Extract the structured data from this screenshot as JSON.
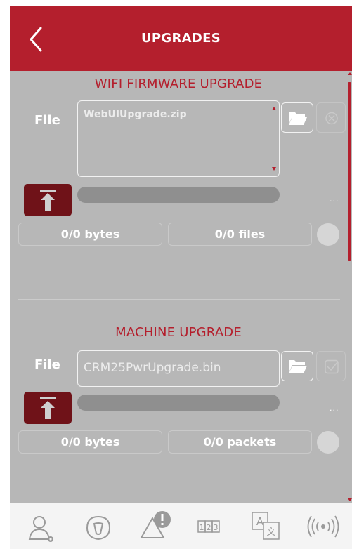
{
  "header": {
    "title": "UPGRADES",
    "back_icon": "chevron-left-icon"
  },
  "colors": {
    "brand_red": "#b41f2d",
    "dark_red": "#6f1218",
    "panel_gray": "#b7b7b7"
  },
  "wifi_section": {
    "title": "WIFI FIRMWARE UPGRADE",
    "file_label": "File",
    "file_value": "WebUIUpgrade.zip",
    "progress": 0,
    "bytes": "0/0 bytes",
    "files": "0/0 files",
    "dots": "..."
  },
  "machine_section": {
    "title": "MACHINE UPGRADE",
    "file_label": "File",
    "file_value": "CRM25PwrUpgrade.bin",
    "progress": 0,
    "bytes": "0/0 bytes",
    "packets": "0/0 packets",
    "dots": "..."
  },
  "bottom_nav": [
    {
      "icon": "user-settings-icon"
    },
    {
      "icon": "machine-icon"
    },
    {
      "icon": "alarm-icon"
    },
    {
      "icon": "counter-icon"
    },
    {
      "icon": "language-icon"
    },
    {
      "icon": "wireless-icon"
    }
  ]
}
